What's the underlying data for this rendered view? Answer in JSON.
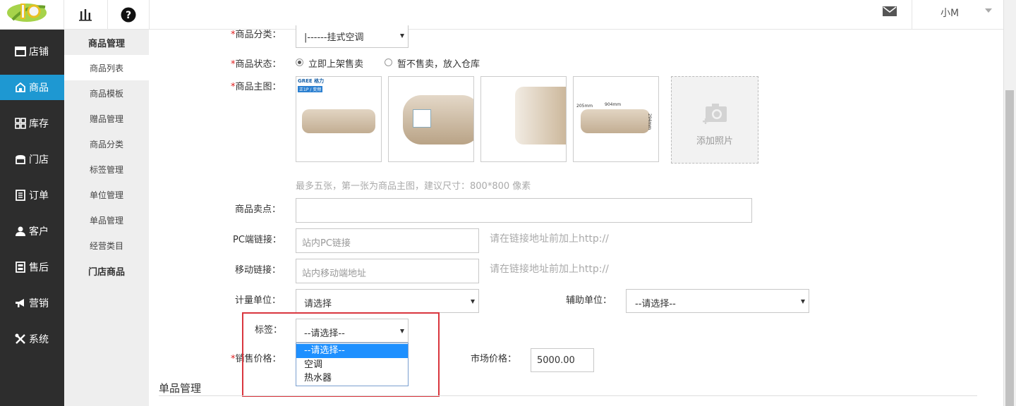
{
  "topbar": {
    "user_name": "小M",
    "icons": [
      "logo",
      "bar-chart-icon",
      "help-icon",
      "mail-icon",
      "chevron-down-icon"
    ]
  },
  "sidebar": {
    "items": [
      {
        "label": "店铺",
        "icon": "store-icon"
      },
      {
        "label": "商品",
        "icon": "goods-icon",
        "active": true
      },
      {
        "label": "库存",
        "icon": "grid-icon"
      },
      {
        "label": "门店",
        "icon": "shop-icon"
      },
      {
        "label": "订单",
        "icon": "order-icon"
      },
      {
        "label": "客户",
        "icon": "user-icon"
      },
      {
        "label": "售后",
        "icon": "service-icon"
      },
      {
        "label": "营销",
        "icon": "megaphone-icon"
      },
      {
        "label": "系统",
        "icon": "tools-icon"
      }
    ],
    "active_color": "#1e98d2"
  },
  "subnav": {
    "header1": "商品管理",
    "items": [
      "商品列表",
      "商品模板",
      "赠品管理",
      "商品分类",
      "标签管理",
      "单位管理",
      "单品管理",
      "经营类目"
    ],
    "header2": "门店商品"
  },
  "form": {
    "category": {
      "label": "商品分类：",
      "value": "|------挂式空调"
    },
    "status": {
      "label": "商品状态：",
      "option1": "立即上架售卖",
      "option2": "暂不售卖，放入仓库"
    },
    "main_image": {
      "label": "商品主图：",
      "add_label": "添加照片",
      "hint": "最多五张，第一张为商品主图，建议尺寸：800*800 像素",
      "brand_text": "GREE 格力",
      "badge_text": "正1P / 变频",
      "dim_width": "904mm",
      "dim_depth": "205mm",
      "dim_height": "294mm"
    },
    "selling_point": {
      "label": "商品卖点：",
      "value": ""
    },
    "pc_link": {
      "label": "PC端链接：",
      "placeholder": "站内PC链接",
      "hint": "请在链接地址前加上http://"
    },
    "mobile_link": {
      "label": "移动链接：",
      "placeholder": "站内移动端地址",
      "hint": "请在链接地址前加上http://"
    },
    "unit": {
      "label": "计量单位：",
      "value": "请选择"
    },
    "aux_unit": {
      "label": "辅助单位：",
      "value": "--请选择--"
    },
    "tag": {
      "label": "标签：",
      "value": "--请选择--",
      "options": [
        "--请选择--",
        "空调",
        "热水器"
      ]
    },
    "sale_price": {
      "label": "销售价格："
    },
    "market_price": {
      "label": "市场价格：",
      "value": "5000.00"
    },
    "required_mark": "*"
  },
  "section": {
    "title": "单品管理"
  }
}
